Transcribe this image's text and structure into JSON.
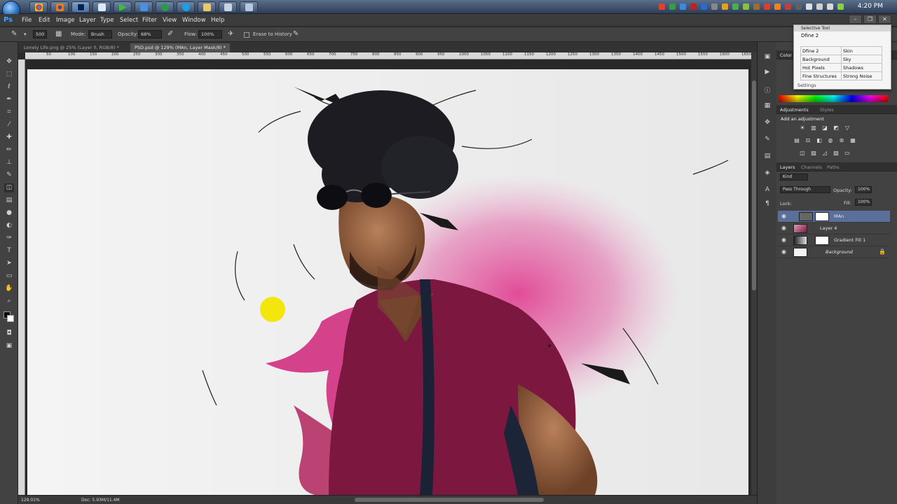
{
  "clock": "4:20 PM",
  "menu": [
    "File",
    "Edit",
    "Image",
    "Layer",
    "Type",
    "Select",
    "Filter",
    "View",
    "Window",
    "Help"
  ],
  "options": {
    "brush_size": "500",
    "mode_label": "Mode:",
    "mode_value": "Brush",
    "opacity_label": "Opacity:",
    "opacity_value": "68%",
    "flow_label": "Flow:",
    "flow_value": "100%",
    "erase_history": "Erase to History"
  },
  "tabs": [
    {
      "label": "Lonely Life.png @ 25% (Layer 0, RGB/8) *"
    },
    {
      "label": "PSD.psd @ 129% (MAn, Layer Mask/8) *"
    }
  ],
  "ruler": [
    "50",
    "100",
    "150",
    "200",
    "250",
    "300",
    "350",
    "400",
    "450",
    "500",
    "550",
    "600",
    "650",
    "700",
    "750",
    "800",
    "850",
    "900",
    "950",
    "1000",
    "1050",
    "1100",
    "1150",
    "1200",
    "1250",
    "1300",
    "1350",
    "1400",
    "1450",
    "1500",
    "1550",
    "1600",
    "1650"
  ],
  "status": {
    "zoom": "129.01%",
    "doc": "Doc: 5.93M/11.4M"
  },
  "selective_tool": {
    "caption": "Selective Tool",
    "name": "Dfine 2",
    "rows": [
      [
        "Dfine 2",
        "Skin"
      ],
      [
        "Background",
        "Sky"
      ],
      [
        "Hot Pixels",
        "Shadows"
      ],
      [
        "Fine Structures",
        "Strong Noise"
      ]
    ],
    "settings": "Settings"
  },
  "color_tab": "Color",
  "adjustments": {
    "tabs": [
      "Adjustments",
      "Styles"
    ],
    "heading": "Add an adjustment"
  },
  "layers_panel": {
    "tabs": [
      "Layers",
      "Channels",
      "Paths"
    ],
    "kind": "Kind",
    "blend": "Pass Through",
    "opacity_label": "Opacity:",
    "opacity": "100%",
    "lock_label": "Lock:",
    "fill_label": "Fill:",
    "fill": "100%",
    "layers": [
      {
        "name": "MAn",
        "selected": true
      },
      {
        "name": "Layer 4",
        "selected": false
      },
      {
        "name": "Gradient Fill 1",
        "selected": false
      },
      {
        "name": "Background",
        "selected": false
      }
    ]
  },
  "colors": {
    "accent": "#5a6f9a",
    "canvas": "#f0f0f0",
    "shirt": "#8b1a4e",
    "splash": "#d6307e",
    "dot": "#f2e60c"
  }
}
